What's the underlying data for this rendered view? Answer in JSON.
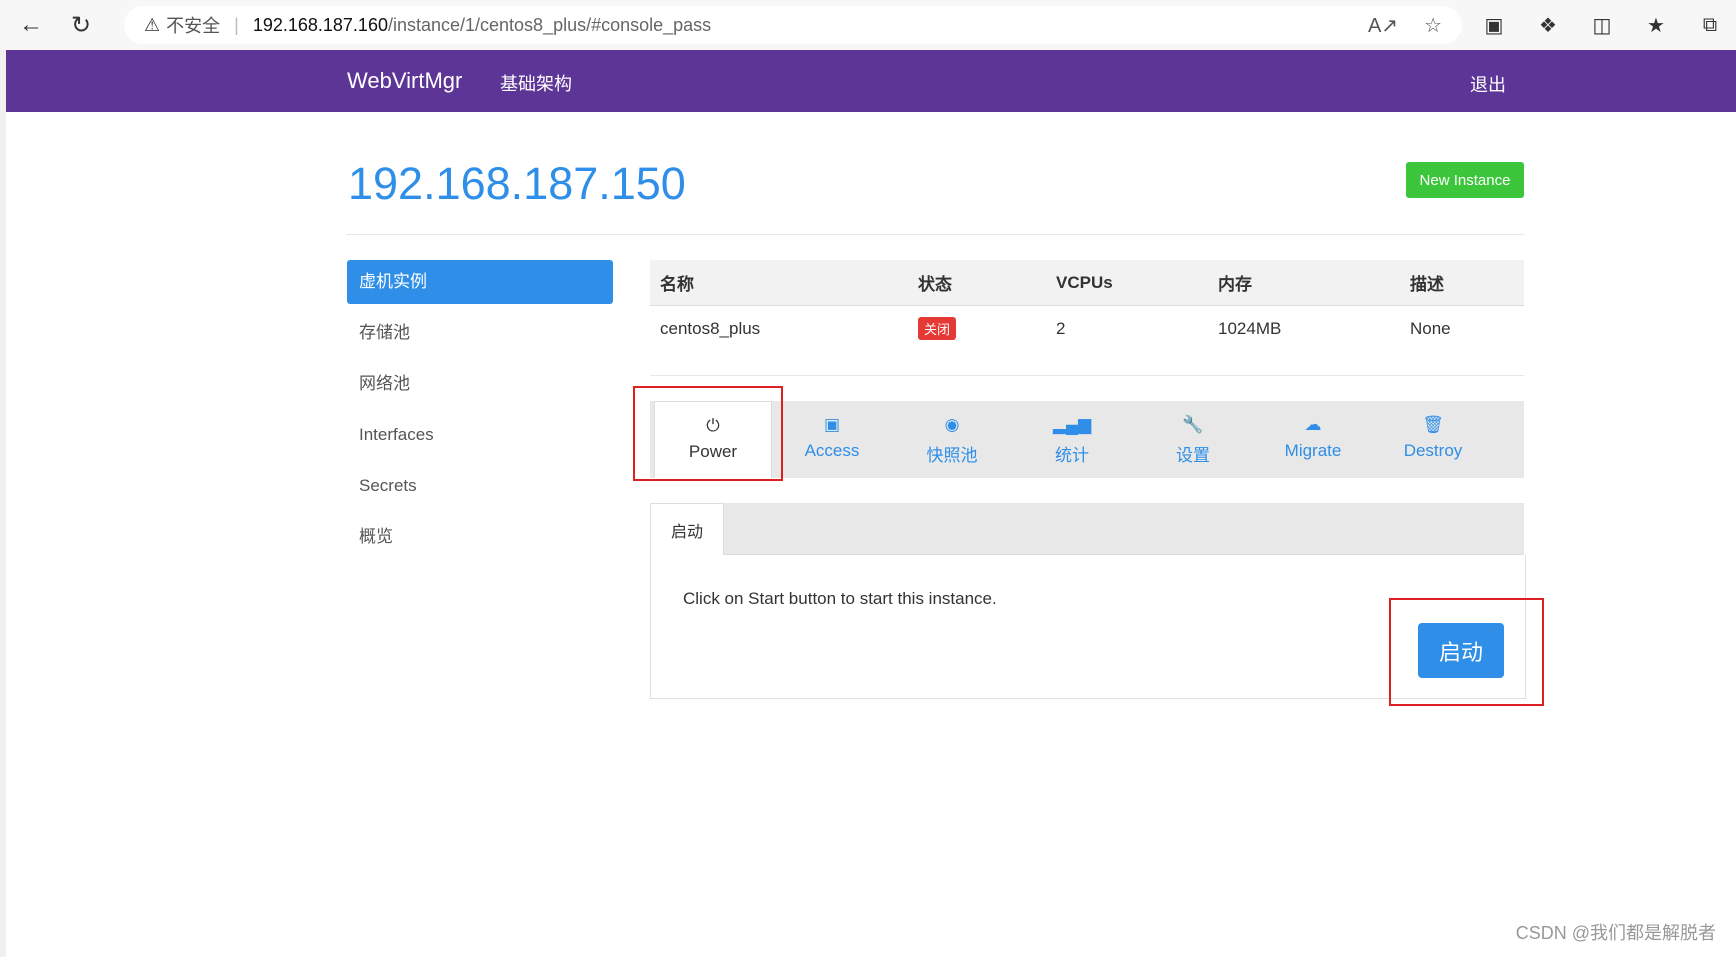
{
  "browser": {
    "security_label": "不安全",
    "url_host": "192.168.187.160",
    "url_path": "/instance/1/centos8_plus/#console_pass"
  },
  "navbar": {
    "brand": "WebVirtMgr",
    "nav_item": "基础架构",
    "logout": "退出",
    "bg_color": "#5c3596"
  },
  "header": {
    "host_title": "192.168.187.150",
    "new_instance_label": "New Instance"
  },
  "sidebar": {
    "items": [
      {
        "label": "虚机实例",
        "active": true
      },
      {
        "label": "存储池"
      },
      {
        "label": "网络池"
      },
      {
        "label": "Interfaces"
      },
      {
        "label": "Secrets"
      },
      {
        "label": "概览"
      }
    ]
  },
  "instance_table": {
    "headers": [
      "名称",
      "状态",
      "VCPUs",
      "内存",
      "描述"
    ],
    "row": {
      "name": "centos8_plus",
      "status": "关闭",
      "vcpus": "2",
      "memory": "1024MB",
      "description": "None"
    }
  },
  "tabs": [
    {
      "label": "Power",
      "icon": "power-icon",
      "active": true
    },
    {
      "label": "Access",
      "icon": "briefcase-icon"
    },
    {
      "label": "快照池",
      "icon": "camera-icon"
    },
    {
      "label": "统计",
      "icon": "signal-icon"
    },
    {
      "label": "设置",
      "icon": "wrench-icon"
    },
    {
      "label": "Migrate",
      "icon": "cloud-upload-icon"
    },
    {
      "label": "Destroy",
      "icon": "trash-icon"
    }
  ],
  "power_panel": {
    "subtab": "启动",
    "message": "Click on Start button to start this instance.",
    "start_button": "启动"
  },
  "watermark": "CSDN @我们都是解脱者"
}
